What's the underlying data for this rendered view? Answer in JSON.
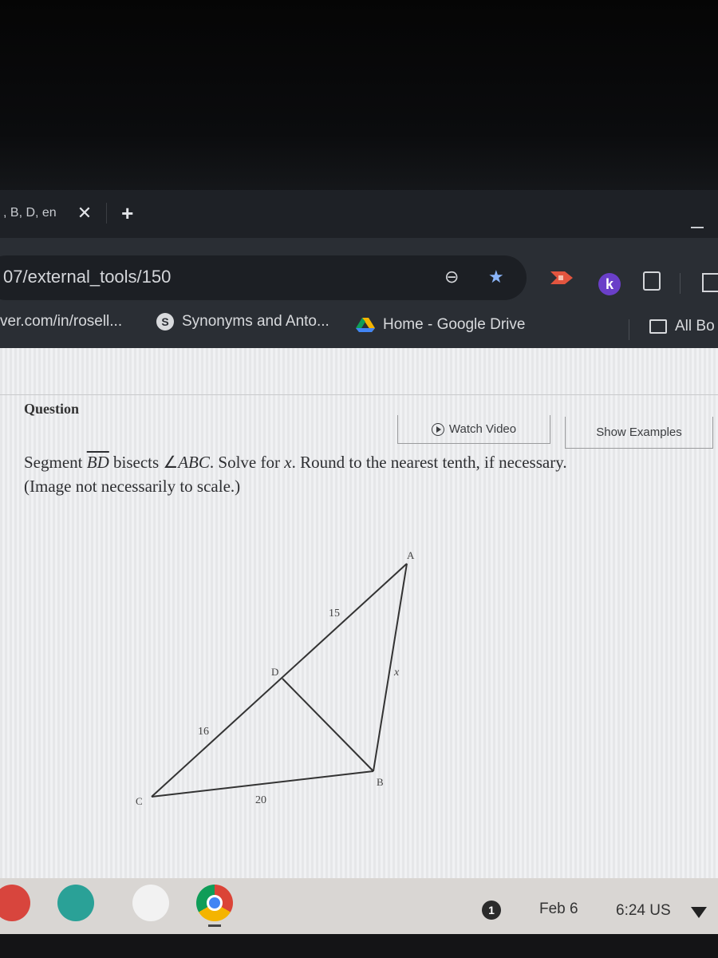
{
  "browser": {
    "tab": {
      "title": ", B, D, en",
      "close_icon": "✕",
      "new_tab_icon": "+"
    },
    "omnibox": {
      "url": "07/external_tools/150"
    },
    "extensions": [
      "screen-recorder-icon",
      "kami-k-icon",
      "puzzle-icon"
    ],
    "extension_k_label": "k",
    "bookmarks": [
      {
        "label": "ver.com/in/rosell...",
        "icon": "none"
      },
      {
        "label": "Synonyms and Anto...",
        "icon": "globe-icon"
      },
      {
        "label": "Home - Google Drive",
        "icon": "google-drive-icon"
      }
    ],
    "all_bookmarks": "All Bo"
  },
  "question": {
    "heading": "Question",
    "watch_video": "Watch Video",
    "show_examples": "Show Examples",
    "text_parts": {
      "p1": "Segment ",
      "segment": "BD",
      "p2": " bisects ∠",
      "angle": "ABC",
      "p3": ". Solve for ",
      "var": "x",
      "p4": ". Round to the nearest tenth, if necessary.",
      "note": "(Image not necessarily to scale.)"
    },
    "figure": {
      "points": {
        "A": "A",
        "B": "B",
        "C": "C",
        "D": "D"
      },
      "labels": {
        "AD": "15",
        "DC": "16",
        "CB": "20",
        "AB": "x"
      }
    }
  },
  "shelf": {
    "apps": [
      "paint-app-icon",
      "classroom-app-icon",
      "pearson-app-icon",
      "chrome-icon"
    ],
    "notification_count": "1",
    "date": "Feb 6",
    "time": "6:24 US"
  }
}
